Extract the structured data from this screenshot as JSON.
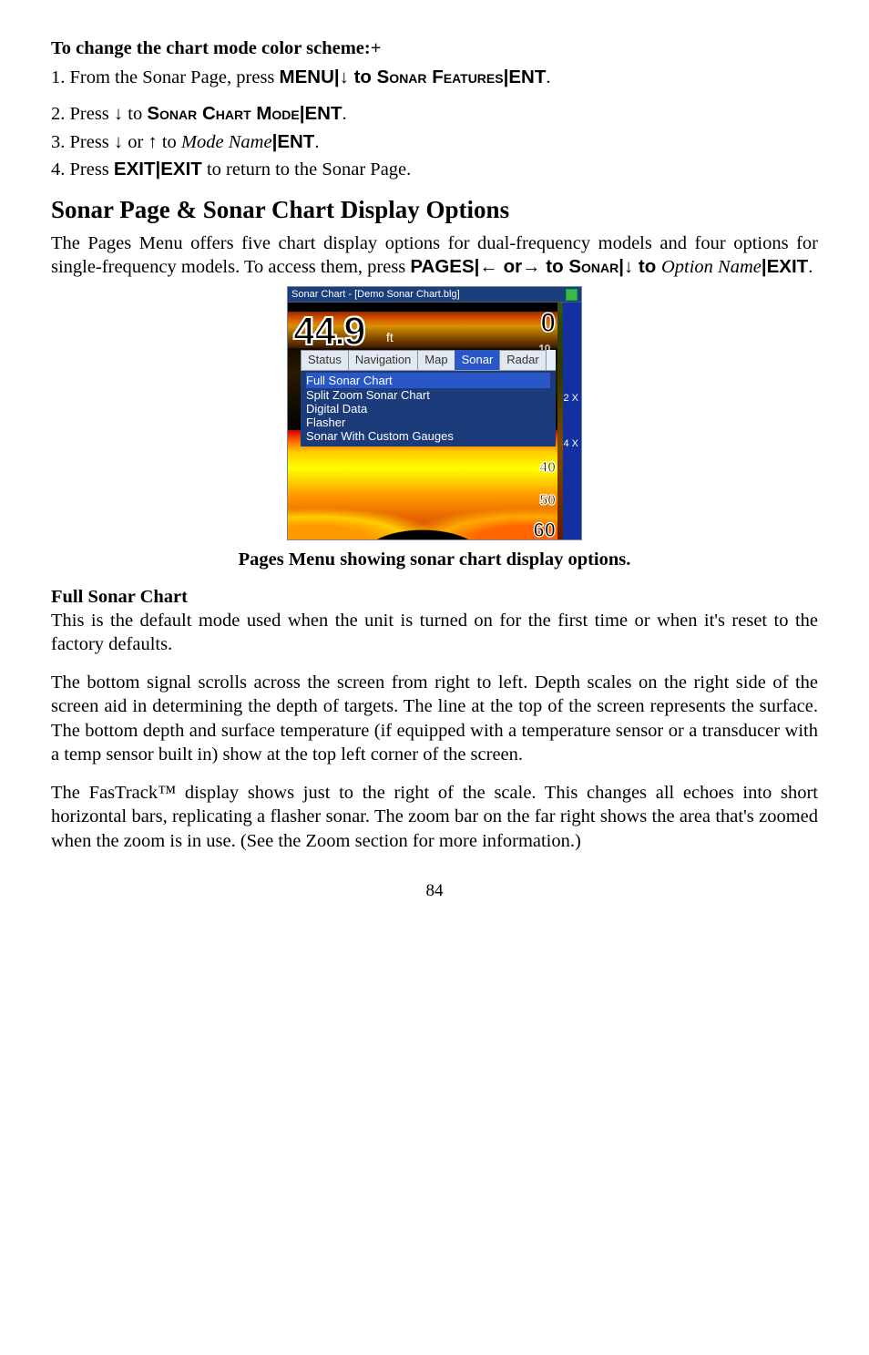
{
  "heading1": "To change the chart mode color scheme:+",
  "step1_a": "1. From the Sonar Page, press ",
  "step1_menu": "MENU",
  "step1_b": "|↓ to ",
  "step1_feat": "Sonar Features",
  "step1_c": "|",
  "step1_ent": "ENT",
  "step1_d": ".",
  "step2_a": "2. Press ↓ to ",
  "step2_mode": "Sonar Chart Mode",
  "step2_b": "|",
  "step2_ent": "ENT",
  "step2_c": ".",
  "step3_a": "3. Press ↓ or ↑ to ",
  "step3_mn": "Mode Name",
  "step3_b": "|",
  "step3_ent": "ENT",
  "step3_c": ".",
  "step4_a": "4. Press ",
  "step4_exit1": "EXIT",
  "step4_b": "|",
  "step4_exit2": "EXIT",
  "step4_c": " to return to the Sonar Page.",
  "section_title": "Sonar Page & Sonar Chart Display Options",
  "intro_a": "The Pages Menu offers five chart display options for dual-frequency models and four options for single-frequency models. To access them, press ",
  "intro_pages": "PAGES",
  "intro_b": "|← or→ to ",
  "intro_sonar": "Sonar",
  "intro_c": "|↓ to ",
  "intro_opt": "Option Name",
  "intro_d": "|",
  "intro_exit": "EXIT",
  "intro_e": ".",
  "fig_title": "Sonar Chart - [Demo Sonar Chart.blg]",
  "fig_depth": "44.9",
  "fig_unit": "ft",
  "fig_zero": "0",
  "fig_scale_10": "10",
  "fig_scale_40": "40",
  "fig_scale_50": "50",
  "fig_scale_60": "60",
  "fig_zoom2": "2\nX",
  "fig_zoom4": "4\nX",
  "tab_status": "Status",
  "tab_nav": "Navigation",
  "tab_map": "Map",
  "tab_sonar": "Sonar",
  "tab_radar": "Radar",
  "opt1": "Full Sonar Chart",
  "opt2": "Split Zoom Sonar Chart",
  "opt3": "Digital Data",
  "opt4": "Flasher",
  "opt5": "Sonar With Custom Gauges",
  "caption": "Pages Menu showing sonar chart display options.",
  "sub_full": "Full Sonar Chart",
  "full_p1": "This is the default mode used when the unit is turned on for the first time or when it's reset to the factory defaults.",
  "full_p2": "The bottom signal scrolls across the screen from right to left. Depth scales on the right side of the screen aid in determining the depth of targets. The line at the top of the screen represents the surface. The bottom depth and surface temperature (if equipped with a temperature sensor or a transducer with a temp sensor built in) show at the top left corner of the screen.",
  "full_p3": "The FasTrack™ display shows just to the right of the scale. This changes all echoes into short horizontal bars, replicating a flasher sonar. The zoom bar on the far right shows the area that's zoomed when the zoom is in use. (See the Zoom section for more information.)",
  "pagenum": "84"
}
